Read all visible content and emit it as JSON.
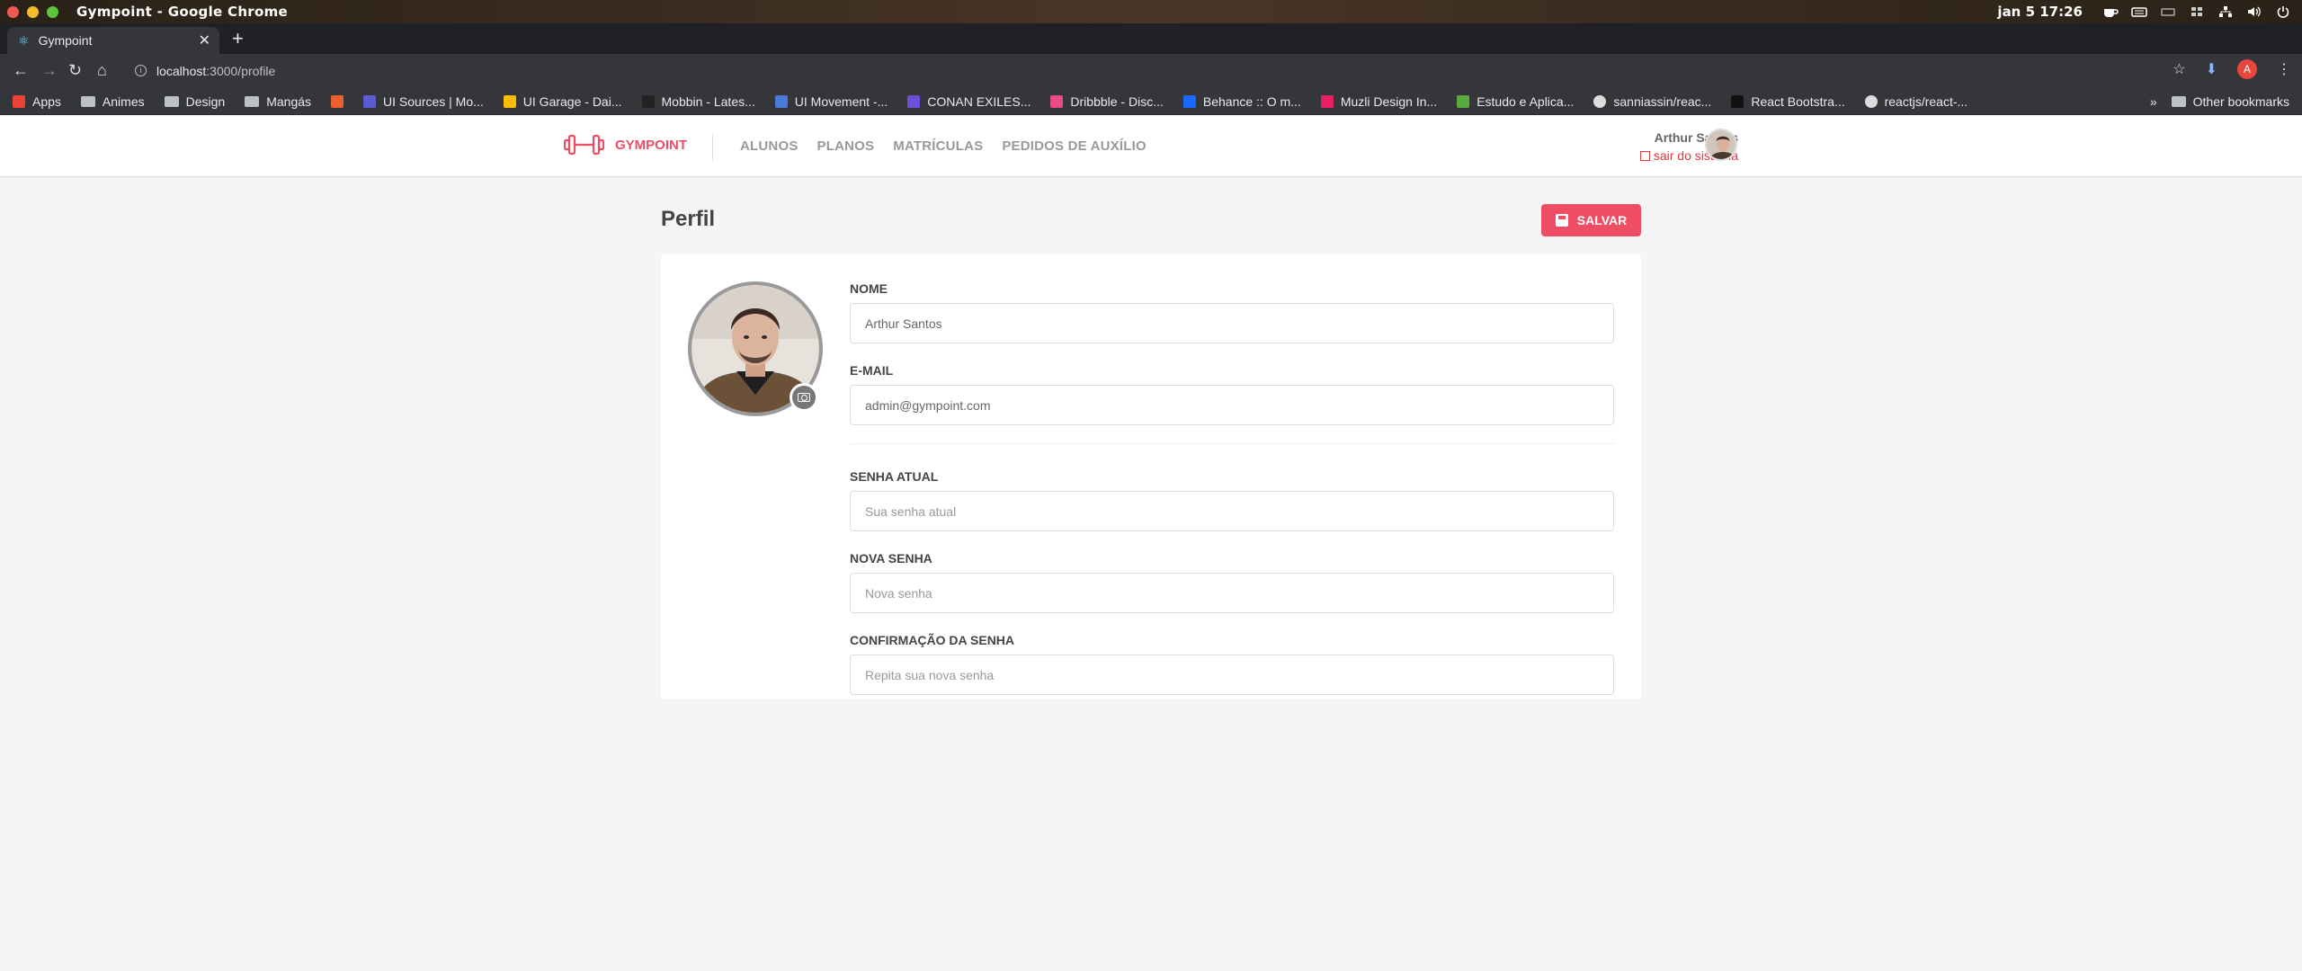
{
  "os": {
    "window_title": "Gympoint - Google Chrome",
    "clock": "jan 5  17:26"
  },
  "browser": {
    "tab_title": "Gympoint",
    "url_host": "localhost",
    "url_path": ":3000/profile",
    "profile_initial": "A"
  },
  "bookmarks": {
    "items": [
      {
        "label": "Apps",
        "icon": "apps-grid-icon",
        "color": "#ea4335"
      },
      {
        "label": "Animes",
        "icon": "folder-icon"
      },
      {
        "label": "Design",
        "icon": "folder-icon"
      },
      {
        "label": "Mangás",
        "icon": "folder-icon"
      },
      {
        "label": "",
        "icon": "site-icon",
        "color": "#e8612c"
      },
      {
        "label": "UI Sources | Mo...",
        "icon": "site-icon",
        "color": "#5b5bd6"
      },
      {
        "label": "UI Garage - Dai...",
        "icon": "site-icon",
        "color": "#fbbc05"
      },
      {
        "label": "Mobbin - Lates...",
        "icon": "site-icon",
        "color": "#222222"
      },
      {
        "label": "UI Movement -...",
        "icon": "site-icon",
        "color": "#4a7bd8"
      },
      {
        "label": "CONAN EXILES...",
        "icon": "site-icon",
        "color": "#6b4fd8"
      },
      {
        "label": "Dribbble - Disc...",
        "icon": "site-icon",
        "color": "#ea4c89"
      },
      {
        "label": "Behance :: O m...",
        "icon": "site-icon",
        "color": "#1769ff"
      },
      {
        "label": "Muzli Design In...",
        "icon": "site-icon",
        "color": "#e91e63"
      },
      {
        "label": "Estudo e Aplica...",
        "icon": "site-icon",
        "color": "#5aa93c"
      },
      {
        "label": "sanniassin/reac...",
        "icon": "github-icon",
        "color": "#dddddd"
      },
      {
        "label": "React Bootstra...",
        "icon": "site-icon",
        "color": "#111111"
      },
      {
        "label": "reactjs/react-...",
        "icon": "github-icon",
        "color": "#dddddd"
      }
    ],
    "other_label": "Other bookmarks",
    "overflow": "»"
  },
  "header": {
    "logo_text": "GYMPOINT",
    "nav": [
      "ALUNOS",
      "PLANOS",
      "MATRÍCULAS",
      "PEDIDOS DE AUXÍLIO"
    ],
    "user_name": "Arthur Santos",
    "logout_label": "sair do sistema"
  },
  "page": {
    "title": "Perfil",
    "save_label": "SALVAR"
  },
  "form": {
    "name_label": "NOME",
    "name_value": "Arthur Santos",
    "email_label": "E-MAIL",
    "email_value": "admin@gympoint.com",
    "old_password_label": "SENHA ATUAL",
    "old_password_placeholder": "Sua senha atual",
    "password_label": "NOVA SENHA",
    "password_placeholder": "Nova senha",
    "confirm_label": "CONFIRMAÇÃO DA SENHA",
    "confirm_placeholder": "Repita sua nova senha"
  },
  "colors": {
    "accent": "#ee4d64",
    "logout": "#de3b3b",
    "background": "#f5f5f5"
  }
}
